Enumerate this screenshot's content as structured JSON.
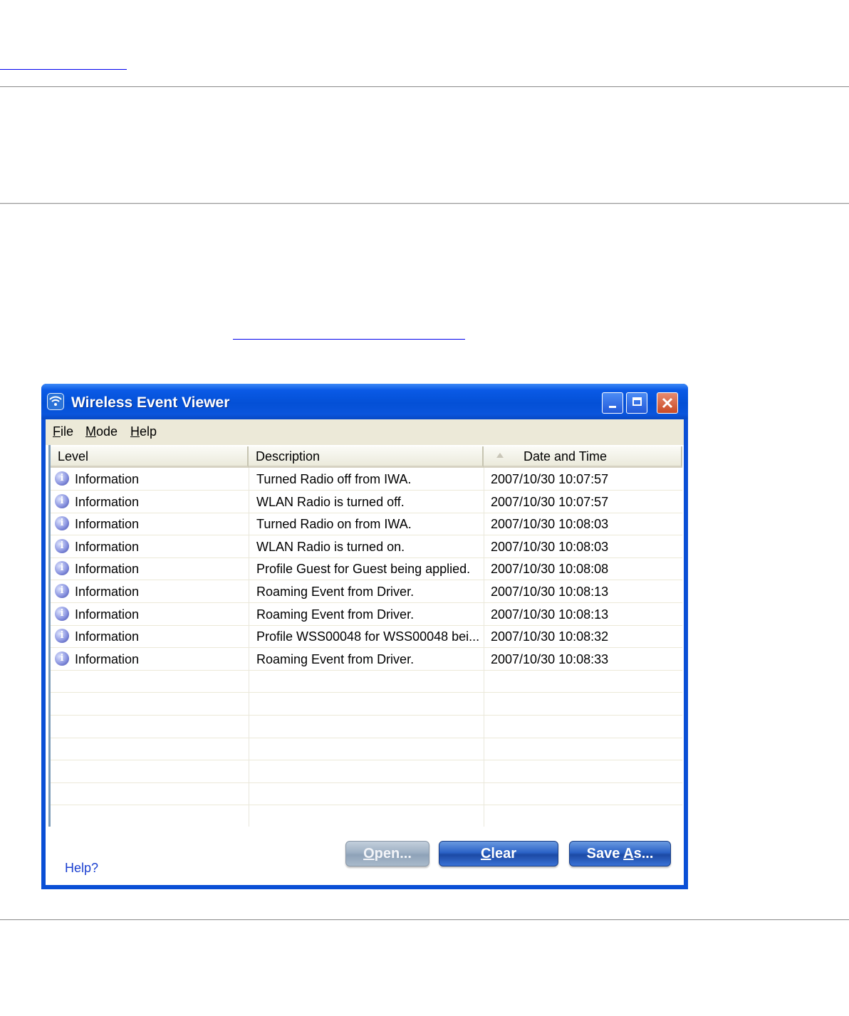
{
  "window": {
    "title": "Wireless Event Viewer",
    "controls": {
      "minimize": "_",
      "maximize": "□",
      "close": "×"
    }
  },
  "menu": [
    {
      "prefix": "",
      "accel": "F",
      "rest": "ile"
    },
    {
      "prefix": "",
      "accel": "M",
      "rest": "ode"
    },
    {
      "prefix": "",
      "accel": "H",
      "rest": "elp"
    }
  ],
  "table": {
    "columns": [
      "Level",
      "Description",
      "Date and Time"
    ],
    "sorted_column": "Date and Time",
    "rows": [
      {
        "level": "Information",
        "description": "Turned Radio off from IWA.",
        "datetime": "2007/10/30 10:07:57"
      },
      {
        "level": "Information",
        "description": "WLAN Radio is turned off.",
        "datetime": "2007/10/30 10:07:57"
      },
      {
        "level": "Information",
        "description": "Turned Radio on from IWA.",
        "datetime": "2007/10/30 10:08:03"
      },
      {
        "level": "Information",
        "description": "WLAN Radio is turned on.",
        "datetime": "2007/10/30 10:08:03"
      },
      {
        "level": "Information",
        "description": "Profile Guest for Guest being applied.",
        "datetime": "2007/10/30 10:08:08"
      },
      {
        "level": "Information",
        "description": "Roaming Event from Driver.",
        "datetime": "2007/10/30 10:08:13"
      },
      {
        "level": "Information",
        "description": "Roaming Event from Driver.",
        "datetime": "2007/10/30 10:08:13"
      },
      {
        "level": "Information",
        "description": "Profile WSS00048 for WSS00048 bei...",
        "datetime": "2007/10/30 10:08:32"
      },
      {
        "level": "Information",
        "description": "Roaming Event from Driver.",
        "datetime": "2007/10/30 10:08:33"
      }
    ],
    "empty_rows": 7
  },
  "footer": {
    "help_link": "Help?",
    "buttons": {
      "open": {
        "accel": "O",
        "rest": "pen...",
        "pre": "",
        "disabled": true
      },
      "clear": {
        "accel": "C",
        "rest": "lear",
        "pre": "",
        "disabled": false
      },
      "saveas": {
        "pre": "Save ",
        "accel": "A",
        "rest": "s...",
        "disabled": false
      }
    }
  },
  "colors": {
    "titlebar": "#0a54dc",
    "menubar": "#ece9d8",
    "link": "#1a3fd0"
  }
}
